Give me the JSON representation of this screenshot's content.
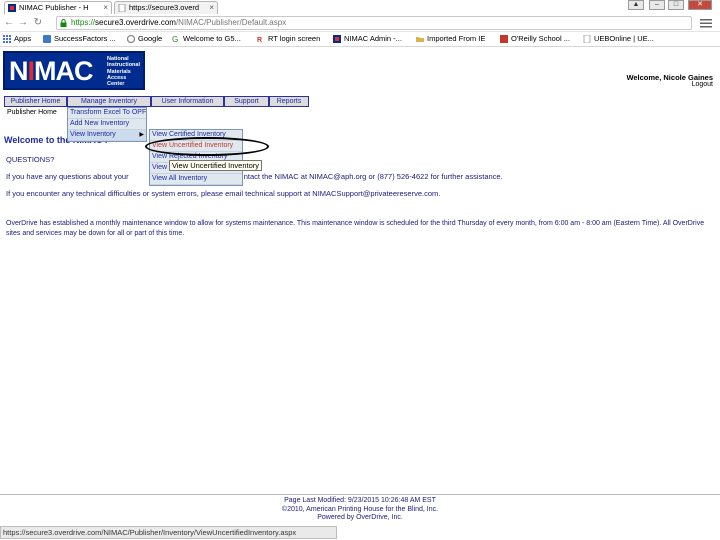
{
  "browser": {
    "tabs": [
      {
        "title": "NIMAC Publisher - H"
      },
      {
        "title": "https://secure3.overd"
      }
    ],
    "url": {
      "scheme": "https://",
      "host": "secure3.overdrive.com",
      "path": "/NIMAC/Publisher/Default.aspx"
    },
    "bookmarks": [
      {
        "label": "Apps",
        "color": "#4a6fd1"
      },
      {
        "label": "SuccessFactors ...",
        "color": "#3e7bc4"
      },
      {
        "label": "Google",
        "color": "#888888"
      },
      {
        "label": "Welcome to G5...",
        "color": "#3a7a3a"
      },
      {
        "label": "RT login screen",
        "color": "#c0392b"
      },
      {
        "label": "NIMAC Admin -...",
        "color": "#002b8f"
      },
      {
        "label": "Imported From IE",
        "color": "#d9b44a"
      },
      {
        "label": "O'Reilly School ...",
        "color": "#c0392b"
      },
      {
        "label": "UEBOnline | UE...",
        "color": "#999999"
      }
    ],
    "status_url": "https://secure3.overdrive.com/NIMAC/Publisher/Inventory/ViewUncertifiedInventory.aspx"
  },
  "header": {
    "logo_text_pre": "N",
    "logo_text_i": "I",
    "logo_text_post": "MAC",
    "logo_tagline": "National Instructional Materials Access Center",
    "welcome": "Welcome, Nicole Gaines",
    "logout": "Logout"
  },
  "nav": {
    "items": [
      "Publisher Home",
      "Manage Inventory",
      "User Information",
      "Support",
      "Reports"
    ],
    "sub_label": "Publisher Home"
  },
  "dropdown": {
    "items": [
      "Transform Excel To OPF",
      "Add New Inventory",
      "View Inventory"
    ],
    "submenu": [
      "View Certified Inventory",
      "View Uncertified Inventory",
      "View Rejected Inventory",
      "View Pending Inventory",
      "View All Inventory"
    ],
    "tooltip": "View Uncertified Inventory"
  },
  "main": {
    "heading": "Welcome to the NIMAC P",
    "questions": "QUESTIONS?",
    "line1_pre": "If you have any questions about your",
    "line1_post": "ntact the NIMAC at",
    "line1_email": "NIMAC@aph.org",
    "line1_tail": "or (877) 526-4622 for further assistance.",
    "line2_pre": "If you encounter any technical difficulties or system errors, please email technical support at",
    "line2_email": "NIMACSupport@privateereserve.com",
    "line2_tail": ".",
    "maintenance": "OverDrive has established a monthly maintenance window to allow for systems maintenance. This maintenance window is scheduled for the third Thursday of every month, from 6:00 am - 8:00 am (Eastern Time). All OverDrive sites and services may be down for all or part of this time."
  },
  "footer": {
    "modified": "Page Last Modified: 9/23/2015 10:26:48 AM EST",
    "copyright": "©2010, American Printing House for the Blind, Inc.",
    "powered": "Powered by OverDrive, Inc."
  }
}
